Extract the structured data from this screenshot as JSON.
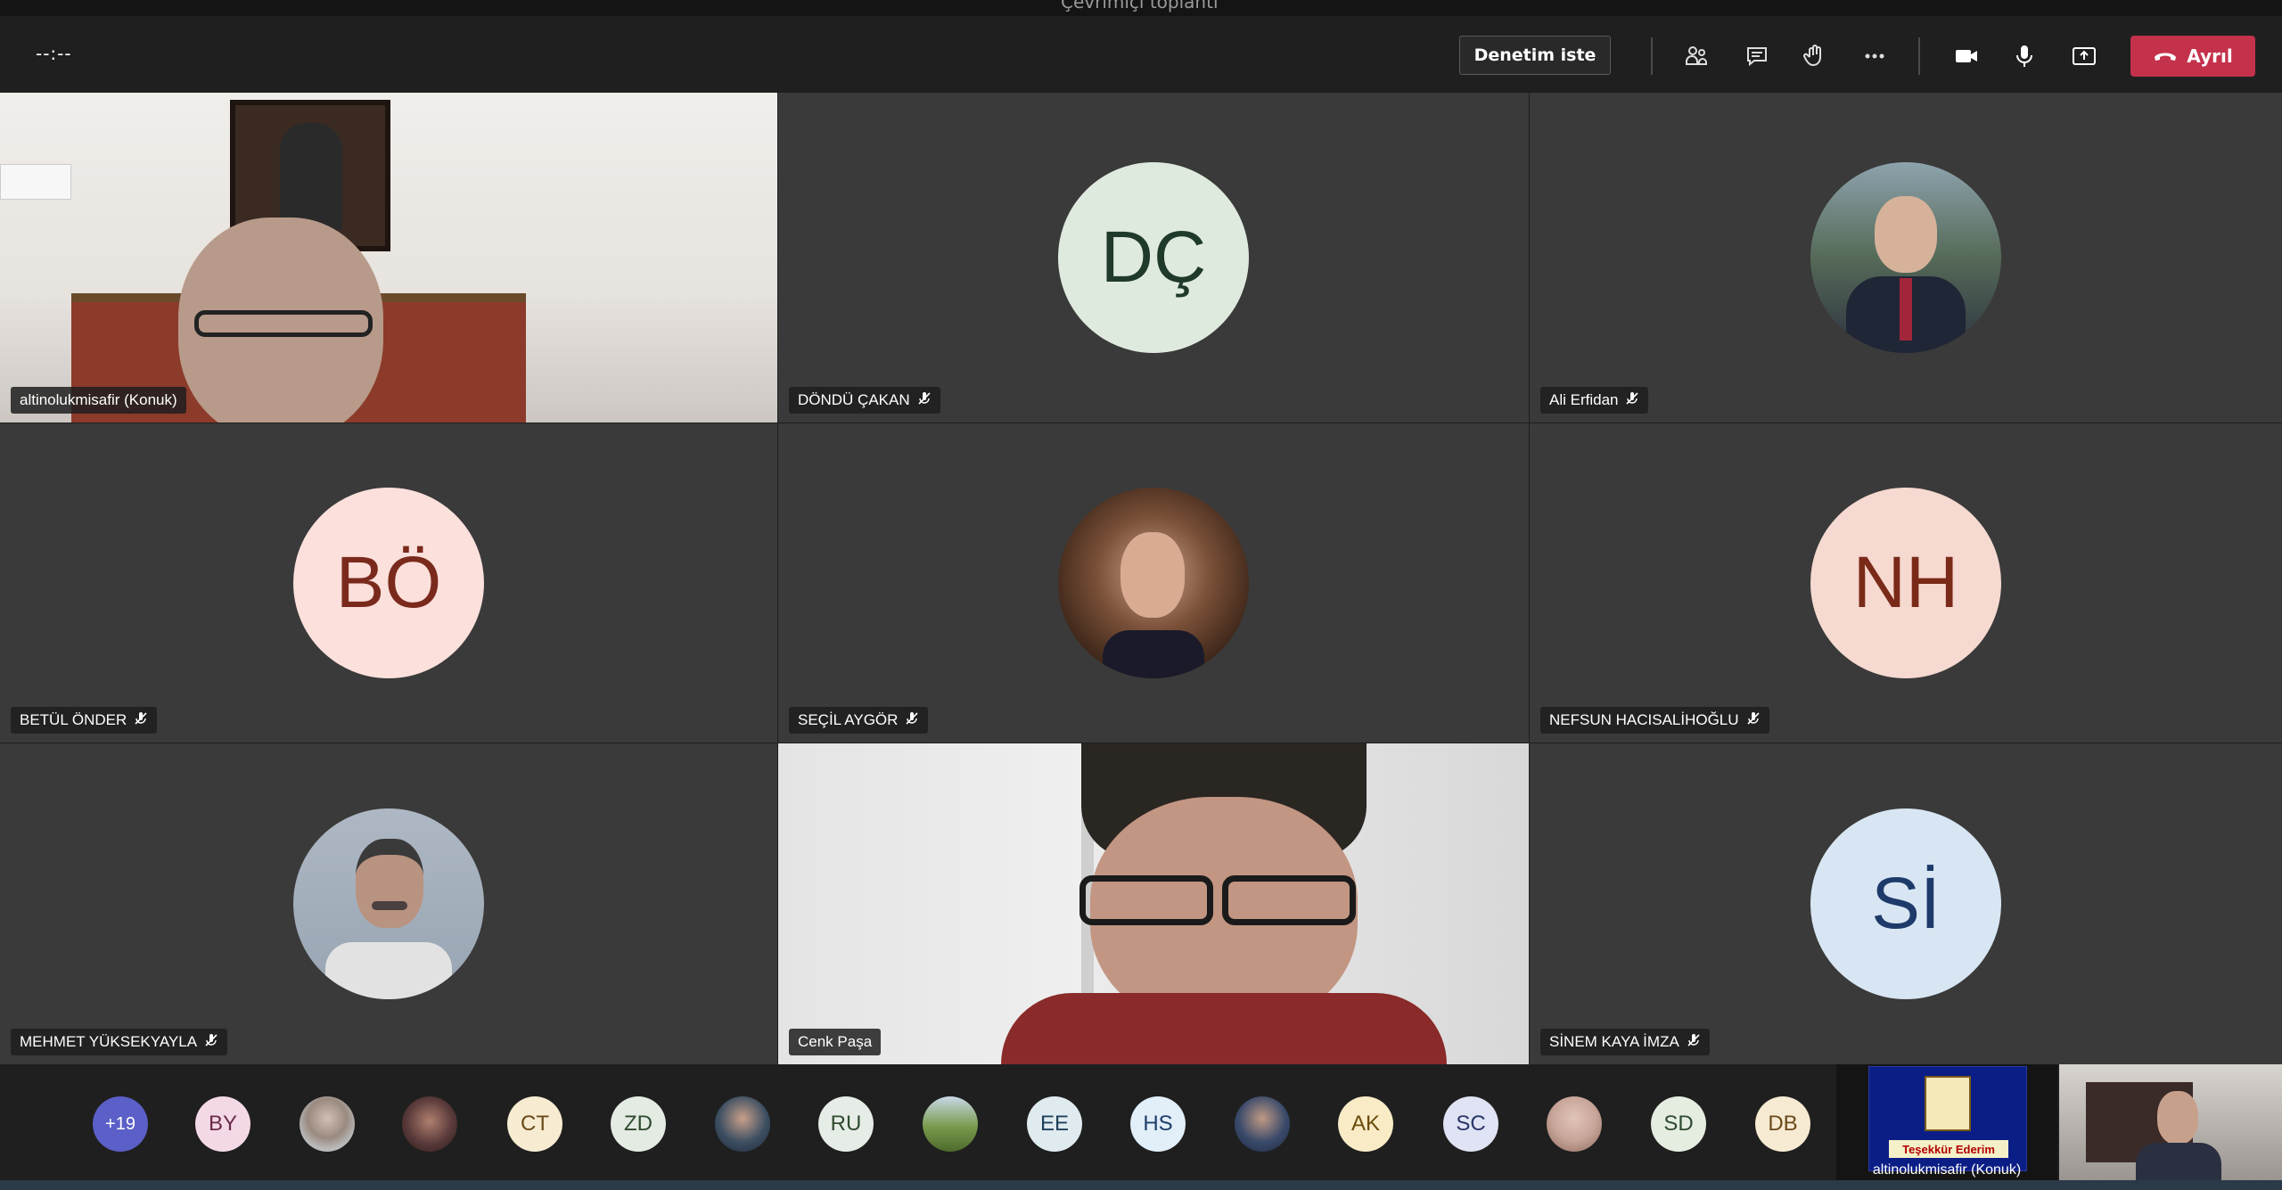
{
  "window": {
    "title": "Çevrimiçi toplantı"
  },
  "controls": {
    "timer": "--:--",
    "request_control_label": "Denetim iste",
    "leave_label": "Ayrıl",
    "icons": [
      "participants-icon",
      "chat-icon",
      "raise-hand-icon",
      "more-options-icon",
      "camera-icon",
      "microphone-icon",
      "share-screen-icon",
      "hang-up-icon"
    ]
  },
  "colors": {
    "leave_button": "#c4314b",
    "tile_bg": "#3a3a3a",
    "app_bg": "#1f1f1f"
  },
  "participants": [
    {
      "name": "altinolukmisafir (Konuk)",
      "type": "video",
      "muted": false
    },
    {
      "name": "DÖNDÜ ÇAKAN",
      "initials": "DÇ",
      "bg": "#dfeadf",
      "fg": "#1f3a2a",
      "muted": true
    },
    {
      "name": "Ali Erfidan",
      "type": "photo",
      "muted": true
    },
    {
      "name": "BETÜL ÖNDER",
      "initials": "BÖ",
      "bg": "#fbe0dc",
      "fg": "#7a2a1c",
      "muted": true
    },
    {
      "name": "SEÇİL AYGÖR",
      "type": "photo",
      "muted": true
    },
    {
      "name": "NEFSUN HACISALİHOĞLU",
      "initials": "NH",
      "bg": "#f6d9d0",
      "fg": "#7a2a18",
      "muted": true
    },
    {
      "name": "MEHMET YÜKSEKYAYLA",
      "type": "photo",
      "muted": true
    },
    {
      "name": "Cenk Paşa",
      "type": "video",
      "muted": false
    },
    {
      "name": "SİNEM KAYA İMZA",
      "initials": "Sİ",
      "bg": "#d8e6f3",
      "fg": "#1d3a6a",
      "muted": true
    }
  ],
  "strip": {
    "more_count": "+19",
    "items": [
      {
        "label": "BY",
        "bg": "#f3d9e6",
        "fg": "#6b2a4a"
      },
      {
        "label": "",
        "photo": true,
        "bg": "#b9b9b9"
      },
      {
        "label": "",
        "photo": true,
        "bg": "#5a3a3a"
      },
      {
        "label": "CT",
        "bg": "#f7ecd2",
        "fg": "#6a4a1a"
      },
      {
        "label": "ZD",
        "bg": "#e3ebe3",
        "fg": "#2f4a2f"
      },
      {
        "label": "",
        "photo": true,
        "bg": "#3d4f62"
      },
      {
        "label": "RU",
        "bg": "#e6ece6",
        "fg": "#2f4a2f"
      },
      {
        "label": "",
        "photo": true,
        "bg": "#5d7a3c"
      },
      {
        "label": "EE",
        "bg": "#e0ebf0",
        "fg": "#1f3f5a"
      },
      {
        "label": "HS",
        "bg": "#e2eef8",
        "fg": "#1d3f6a"
      },
      {
        "label": "",
        "photo": true,
        "bg": "#3a4a6a"
      },
      {
        "label": "AK",
        "bg": "#f8ebc6",
        "fg": "#6a4a0a"
      },
      {
        "label": "SC",
        "bg": "#dfe3f3",
        "fg": "#2a356a"
      },
      {
        "label": "",
        "photo": true,
        "bg": "#c9a59a"
      },
      {
        "label": "SD",
        "bg": "#e5ede0",
        "fg": "#2f4a2f"
      },
      {
        "label": "DB",
        "bg": "#f7ead2",
        "fg": "#6a4a1a"
      }
    ],
    "share_caption": "Teşekkür Ederim",
    "share_owner": "altinolukmisafir (Konuk)"
  }
}
